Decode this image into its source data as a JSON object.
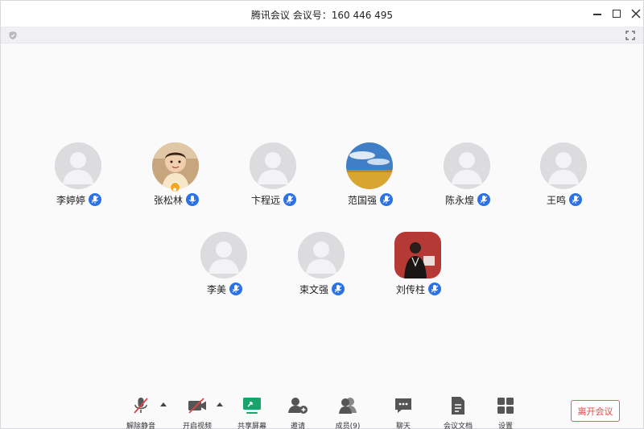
{
  "window": {
    "title": "腾讯会议  会议号：160 446 495"
  },
  "participants": [
    {
      "name": "李婷婷",
      "avatar": "default"
    },
    {
      "name": "张松林",
      "avatar": "photo-child",
      "host": true
    },
    {
      "name": "卞程远",
      "avatar": "default"
    },
    {
      "name": "范国强",
      "avatar": "photo-landscape"
    },
    {
      "name": "陈永煌",
      "avatar": "default"
    },
    {
      "name": "王鸣",
      "avatar": "default"
    },
    {
      "name": "李美",
      "avatar": "default"
    },
    {
      "name": "束文强",
      "avatar": "default"
    },
    {
      "name": "刘传柱",
      "avatar": "photo-person-red"
    }
  ],
  "toolbar": {
    "unmute": "解除静音",
    "start_video": "开启视频",
    "share_screen": "共享屏幕",
    "invite": "邀请",
    "members": "成员(9)",
    "chat": "聊天",
    "docs": "会议文档",
    "settings": "设置",
    "leave": "离开会议"
  },
  "colors": {
    "accent": "#2a72e6",
    "leave": "#e04545",
    "share": "#1aa36b",
    "muted": "#e04545"
  }
}
